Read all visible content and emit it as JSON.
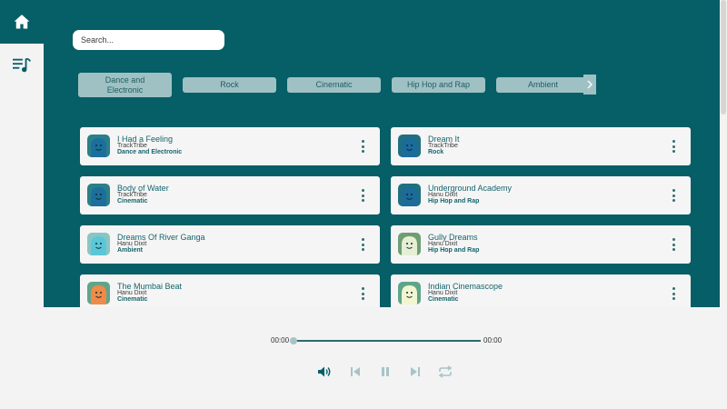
{
  "search": {
    "placeholder": "Search..."
  },
  "icons": {
    "home": "home-icon",
    "playlist": "playlist-icon",
    "next": "chevron-right-icon",
    "menu": "kebab-menu-icon"
  },
  "colors": {
    "primary": "#065e66",
    "chip": "#9fc1c4",
    "chip_text": "#1f5d63",
    "card": "#f5f5f5",
    "accent_text": "#15656c"
  },
  "genres": [
    {
      "label": "Dance and Electronic",
      "active": true
    },
    {
      "label": "Rock",
      "active": false
    },
    {
      "label": "Cinematic",
      "active": false
    },
    {
      "label": "Hip Hop and Rap",
      "active": false
    },
    {
      "label": "Ambient",
      "active": false
    }
  ],
  "tracks": [
    {
      "title": "I Had a Feeling",
      "artist": "TrackTribe",
      "genre": "Dance and Electronic",
      "art_bg": "#2a7f88",
      "art_fg": "#1c6f9c"
    },
    {
      "title": "Dream It",
      "artist": "TrackTribe",
      "genre": "Rock",
      "art_bg": "#1f6f80",
      "art_fg": "#1b6b9b"
    },
    {
      "title": "Body of Water",
      "artist": "TrackTribe",
      "genre": "Cinematic",
      "art_bg": "#2a7f88",
      "art_fg": "#1c6f9c"
    },
    {
      "title": "Underground Academy",
      "artist": "Hanu Dixit",
      "genre": "Hip Hop and Rap",
      "art_bg": "#1f6f80",
      "art_fg": "#1b6b9b"
    },
    {
      "title": "Dreams Of River Ganga",
      "artist": "Hanu Dixit",
      "genre": "Ambient",
      "art_bg": "#88c6c3",
      "art_fg": "#5bc6d8"
    },
    {
      "title": "Gully Dreams",
      "artist": "Hanu Dixit",
      "genre": "Hip Hop and Rap",
      "art_bg": "#6d9e74",
      "art_fg": "#e6efd4"
    },
    {
      "title": "The Mumbai Beat",
      "artist": "Hanu Dixit",
      "genre": "Cinematic",
      "art_bg": "#5fa58a",
      "art_fg": "#f08a48"
    },
    {
      "title": "Indian Cinemascope",
      "artist": "Hanu Dixit",
      "genre": "Cinematic",
      "art_bg": "#5fa58a",
      "art_fg": "#f2f5cf"
    }
  ],
  "player": {
    "elapsed": "00:00",
    "duration": "00:00",
    "progress": 0,
    "controls": [
      "volume-icon",
      "previous-icon",
      "pause-icon",
      "next-icon",
      "repeat-icon"
    ]
  }
}
